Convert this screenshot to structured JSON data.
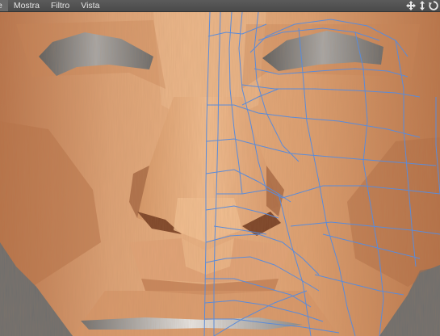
{
  "menu": {
    "items": [
      {
        "label": "e"
      },
      {
        "label": "Mostra"
      },
      {
        "label": "Filtro"
      },
      {
        "label": "Vista"
      }
    ]
  },
  "nav_icons": [
    "move-view-icon",
    "zoom-view-icon",
    "rotate-view-icon"
  ],
  "viewport": {
    "shading": "textured-skin",
    "wireframe_side": "right",
    "colors": {
      "skin_base": "#d9996b",
      "skin_light": "#f0b98b",
      "skin_shadow": "#8f5130",
      "wire": "#5b8bd8",
      "background": "#6d6d6d"
    }
  }
}
